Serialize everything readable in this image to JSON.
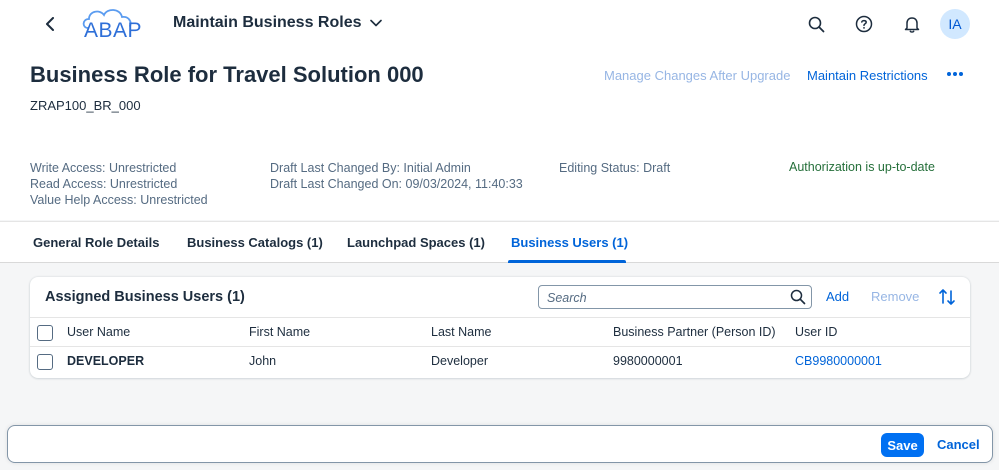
{
  "shell": {
    "logo_text": "ABAP",
    "app_title": "Maintain Business Roles",
    "avatar_initials": "IA"
  },
  "header": {
    "title": "Business Role for Travel Solution 000",
    "subtitle": "ZRAP100_BR_000",
    "actions": {
      "manage_changes": "Manage Changes After Upgrade",
      "maintain_restrictions": "Maintain Restrictions"
    },
    "access": {
      "write": "Write Access: Unrestricted",
      "read": "Read Access: Unrestricted",
      "value_help": "Value Help Access: Unrestricted"
    },
    "draft": {
      "changed_by": "Draft Last Changed By: Initial Admin",
      "changed_on": "Draft Last Changed On: 09/03/2024, 11:40:33"
    },
    "editing_status": "Editing Status: Draft",
    "authorization_status": "Authorization is up-to-date"
  },
  "tabs": [
    {
      "label": "General Role Details"
    },
    {
      "label": "Business Catalogs (1)"
    },
    {
      "label": "Launchpad Spaces (1)"
    },
    {
      "label": "Business Users (1)"
    }
  ],
  "table": {
    "title": "Assigned Business Users (1)",
    "search_placeholder": "Search",
    "add_label": "Add",
    "remove_label": "Remove",
    "columns": [
      "User Name",
      "First Name",
      "Last Name",
      "Business Partner (Person ID)",
      "User ID"
    ],
    "rows": [
      {
        "user_name": "DEVELOPER",
        "first_name": "John",
        "last_name": "Developer",
        "business_partner": "9980000001",
        "user_id": "CB9980000001"
      }
    ]
  },
  "footer": {
    "save_label": "Save",
    "cancel_label": "Cancel"
  },
  "colors": {
    "accent": "#0064d9",
    "success": "#256f3a",
    "disabled_link": "#97b6e4"
  }
}
